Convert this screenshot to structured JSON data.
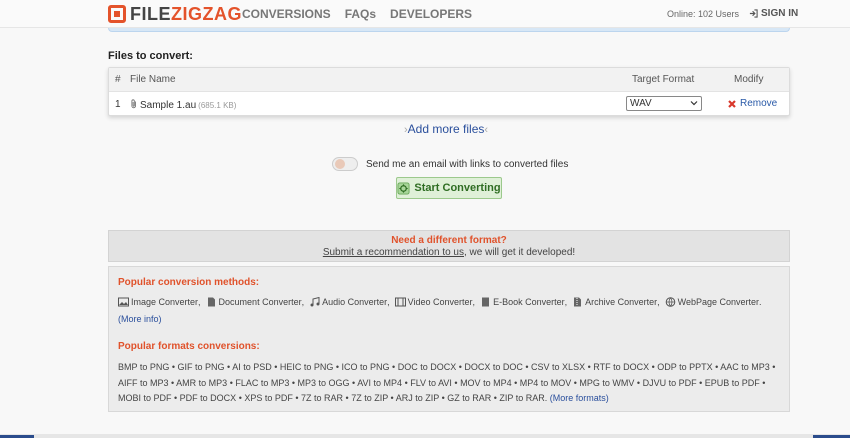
{
  "header": {
    "logo_file": "FILE",
    "logo_zigzag": "ZIGZAG",
    "nav": [
      "CONVERSIONS",
      "FAQs",
      "DEVELOPERS"
    ],
    "online": "Online: 102 Users",
    "signin": "SIGN IN"
  },
  "files": {
    "title": "Files to convert:",
    "columns": {
      "num": "#",
      "name": "File Name",
      "target": "Target Format",
      "modify": "Modify"
    },
    "rows": [
      {
        "num": "1",
        "name": "Sample 1.au",
        "size": "(685.1 KB)",
        "format": "WAV",
        "remove": "Remove"
      }
    ],
    "add_more": "Add more files"
  },
  "email_toggle": {
    "label": "Send me an email with links to converted files",
    "checked": false
  },
  "start_button": "Start Converting",
  "need_format": {
    "title": "Need a different format?",
    "link": "Submit a recommendation to us",
    "suffix": ", we will get it developed!"
  },
  "popular": {
    "methods_title": "Popular conversion methods:",
    "methods": [
      {
        "label": "Image Converter",
        "icon": "image-icon"
      },
      {
        "label": "Document Converter",
        "icon": "document-icon"
      },
      {
        "label": "Audio Converter",
        "icon": "music-note-icon"
      },
      {
        "label": "Video Converter",
        "icon": "film-icon"
      },
      {
        "label": "E-Book Converter",
        "icon": "book-icon"
      },
      {
        "label": "Archive Converter",
        "icon": "archive-icon"
      },
      {
        "label": "WebPage Converter",
        "icon": "globe-icon"
      }
    ],
    "more_info": "(More info)",
    "formats_title": "Popular formats conversions:",
    "formats": [
      "BMP to PNG",
      "GIF to PNG",
      "AI to PSD",
      "HEIC to PNG",
      "ICO to PNG",
      "DOC to DOCX",
      "DOCX to DOC",
      "CSV to XLSX",
      "RTF to DOCX",
      "ODP to PPTX",
      "AAC to MP3",
      "AIFF to MP3",
      "AMR to MP3",
      "FLAC to MP3",
      "MP3 to OGG",
      "AVI to MP4",
      "FLV to AVI",
      "MOV to MP4",
      "MP4 to MOV",
      "MPG to WMV",
      "DJVU to PDF",
      "EPUB to PDF",
      "MOBI to PDF",
      "PDF to DOCX",
      "XPS to PDF",
      "7Z to RAR",
      "7Z to ZIP",
      "ARJ to ZIP",
      "GZ to RAR",
      "ZIP to RAR"
    ],
    "more_formats": "(More formats)"
  },
  "colors": {
    "accent": "#e4532b",
    "link": "#2a4f9c",
    "success_bg": "#dff0d8"
  }
}
